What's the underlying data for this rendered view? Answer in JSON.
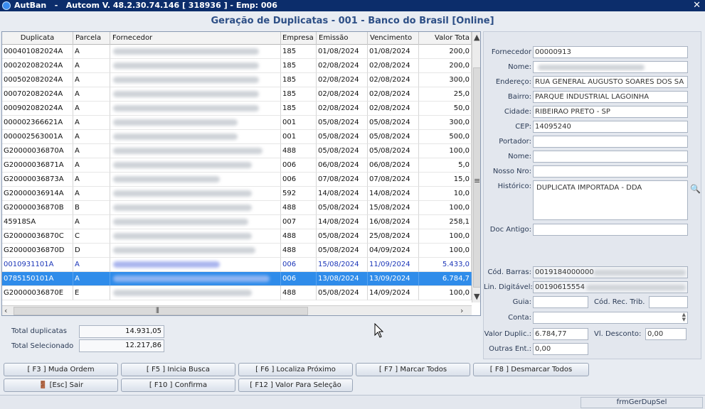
{
  "window": {
    "app": "AutBan",
    "title": "Autcom V. 48.2.30.74.146 [ 318936 ] - Emp: 006",
    "close": "✕"
  },
  "header": "Geração de Duplicatas - 001 - Banco do Brasil [Online]",
  "grid": {
    "columns": [
      "Duplicata",
      "Parcela",
      "Fornecedor",
      "Empresa",
      "Emissão",
      "Vencimento",
      "Valor Tota"
    ],
    "rows": [
      {
        "dup": "000401082024A",
        "par": "A",
        "emp": "185",
        "emi": "01/08/2024",
        "ven": "01/08/2024",
        "val": "200,0"
      },
      {
        "dup": "000202082024A",
        "par": "A",
        "emp": "185",
        "emi": "02/08/2024",
        "ven": "02/08/2024",
        "val": "200,0"
      },
      {
        "dup": "000502082024A",
        "par": "A",
        "emp": "185",
        "emi": "02/08/2024",
        "ven": "02/08/2024",
        "val": "300,0"
      },
      {
        "dup": "000702082024A",
        "par": "A",
        "emp": "185",
        "emi": "02/08/2024",
        "ven": "02/08/2024",
        "val": "25,0"
      },
      {
        "dup": "000902082024A",
        "par": "A",
        "emp": "185",
        "emi": "02/08/2024",
        "ven": "02/08/2024",
        "val": "50,0"
      },
      {
        "dup": "000002366621A",
        "par": "A",
        "emp": "001",
        "emi": "05/08/2024",
        "ven": "05/08/2024",
        "val": "300,0"
      },
      {
        "dup": "000002563001A",
        "par": "A",
        "emp": "001",
        "emi": "05/08/2024",
        "ven": "05/08/2024",
        "val": "500,0"
      },
      {
        "dup": "G20000036870A",
        "par": "A",
        "emp": "488",
        "emi": "05/08/2024",
        "ven": "05/08/2024",
        "val": "100,0"
      },
      {
        "dup": "G20000036871A",
        "par": "A",
        "emp": "006",
        "emi": "06/08/2024",
        "ven": "06/08/2024",
        "val": "5,0"
      },
      {
        "dup": "G20000036873A",
        "par": "A",
        "emp": "006",
        "emi": "07/08/2024",
        "ven": "07/08/2024",
        "val": "15,0"
      },
      {
        "dup": "G20000036914A",
        "par": "A",
        "emp": "592",
        "emi": "14/08/2024",
        "ven": "14/08/2024",
        "val": "10,0"
      },
      {
        "dup": "G20000036870B",
        "par": "B",
        "emp": "488",
        "emi": "05/08/2024",
        "ven": "15/08/2024",
        "val": "100,0"
      },
      {
        "dup": "45918SA",
        "par": "A",
        "emp": "007",
        "emi": "14/08/2024",
        "ven": "16/08/2024",
        "val": "258,1"
      },
      {
        "dup": "G20000036870C",
        "par": "C",
        "emp": "488",
        "emi": "05/08/2024",
        "ven": "25/08/2024",
        "val": "100,0"
      },
      {
        "dup": "G20000036870D",
        "par": "D",
        "emp": "488",
        "emi": "05/08/2024",
        "ven": "04/09/2024",
        "val": "100,0"
      },
      {
        "dup": "0010931101A",
        "par": "A",
        "emp": "006",
        "emi": "15/08/2024",
        "ven": "11/09/2024",
        "val": "5.433,0"
      },
      {
        "dup": "0785150101A",
        "par": "A",
        "emp": "006",
        "emi": "13/08/2024",
        "ven": "13/09/2024",
        "val": "6.784,7"
      },
      {
        "dup": "G20000036870E",
        "par": "E",
        "emp": "488",
        "emi": "05/08/2024",
        "ven": "14/09/2024",
        "val": "100,0"
      }
    ]
  },
  "totals": {
    "dup_label": "Total duplicatas",
    "dup_value": "14.931,05",
    "sel_label": "Total Selecionado",
    "sel_value": "12.217,86"
  },
  "detail": {
    "fornecedor_label": "Fornecedor",
    "fornecedor": "00000913",
    "nome_label": "Nome:",
    "nome": "",
    "endereco_label": "Endereço:",
    "endereco": "RUA GENERAL AUGUSTO SOARES DOS SA",
    "bairro_label": "Bairro:",
    "bairro": "PARQUE INDUSTRIAL LAGOINHA",
    "cidade_label": "Cidade:",
    "cidade": "RIBEIRAO PRETO - SP",
    "cep_label": "CEP:",
    "cep": "14095240",
    "portador_label": "Portador:",
    "portador": "",
    "nome2_label": "Nome:",
    "nome2": "",
    "nosso_label": "Nosso Nro:",
    "nosso": "",
    "historico_label": "Histórico:",
    "historico": "DUPLICATA IMPORTADA - DDA",
    "docantigo_label": "Doc Antigo:",
    "docantigo": "",
    "codbarras_label": "Cód. Barras:",
    "codbarras": "0019184000000",
    "lindig_label": "Lin. Digitável:",
    "lindig": "00190615554",
    "guia_label": "Guia:",
    "guia": "",
    "codrec_label": "Cód. Rec. Trib.",
    "codrec": "",
    "conta_label": "Conta:",
    "conta": "",
    "valor_label": "Valor Duplic.:",
    "valor": "6.784,77",
    "desconto_label": "Vl. Desconto:",
    "desconto": "0,00",
    "outras_label": "Outras Ent.:",
    "outras": "0,00"
  },
  "buttons": {
    "f3": "[ F3 ] Muda Ordem",
    "f5": "[ F5 ] Inicia Busca",
    "f6": "[ F6 ] Localiza Próximo",
    "f7": "[ F7 ] Marcar Todos",
    "f8": "[ F8 ] Desmarcar Todos",
    "esc": "[Esc] Sair",
    "f10": "[ F10 ] Confirma",
    "f12": "[ F12 ] Valor Para Seleção"
  },
  "status": {
    "form": "frmGerDupSel"
  },
  "colors": {
    "title_bg": "#0c2d6b",
    "header_text": "#2d4f86",
    "selected_row": "#2f8cea",
    "blue_row_text": "#1c36b8"
  }
}
